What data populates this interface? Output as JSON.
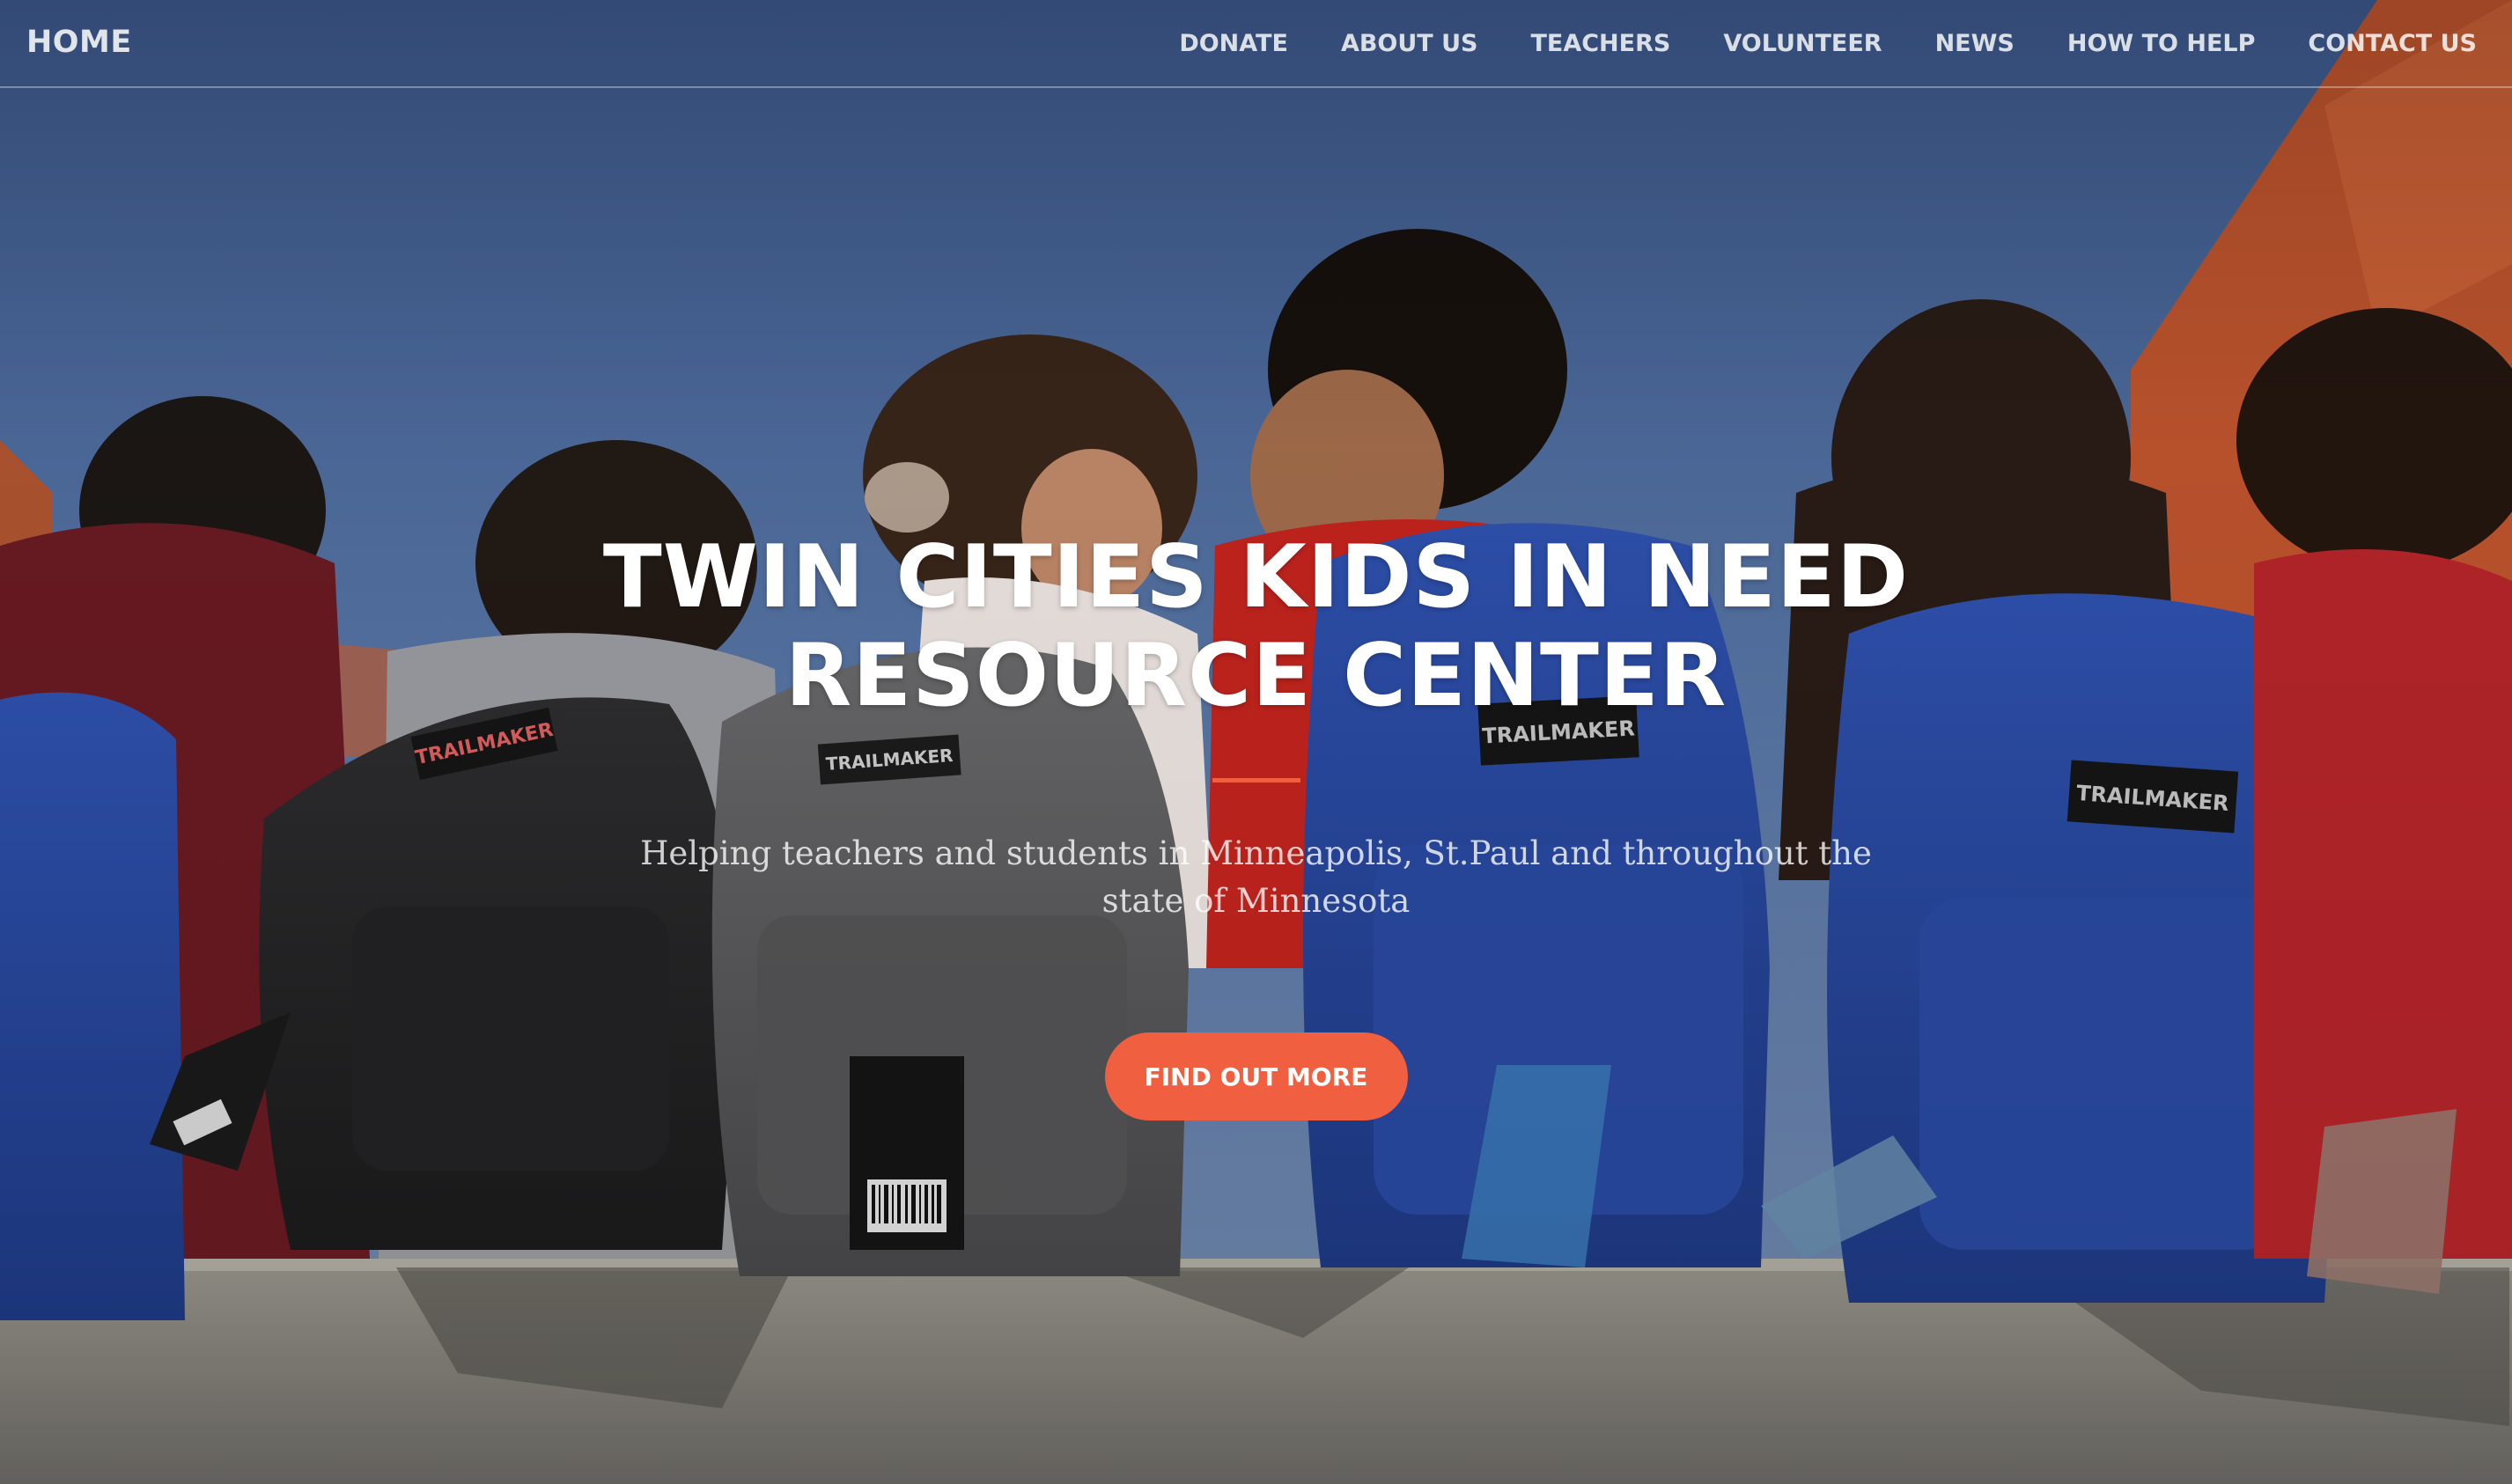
{
  "navbar": {
    "brand": "HOME",
    "links": [
      {
        "label": "DONATE"
      },
      {
        "label": "ABOUT US"
      },
      {
        "label": "TEACHERS"
      },
      {
        "label": "VOLUNTEER"
      },
      {
        "label": "NEWS"
      },
      {
        "label": "HOW TO HELP"
      },
      {
        "label": "CONTACT US"
      }
    ]
  },
  "hero": {
    "title": "TWIN CITIES KIDS IN NEED RESOURCE CENTER",
    "subtitle": "Helping teachers and students in Minneapolis, St.Paul and throughout the state of Minnesota",
    "button_label": "FIND OUT MORE",
    "background_image_description_icon": "photo-kids-with-backpacks",
    "backpack_brand_label": "TRAILMAKER"
  },
  "colors": {
    "accent": "#f05f40",
    "sky": "#4a6a9e",
    "wall": "#8e8c85",
    "text": "#ffffff"
  }
}
